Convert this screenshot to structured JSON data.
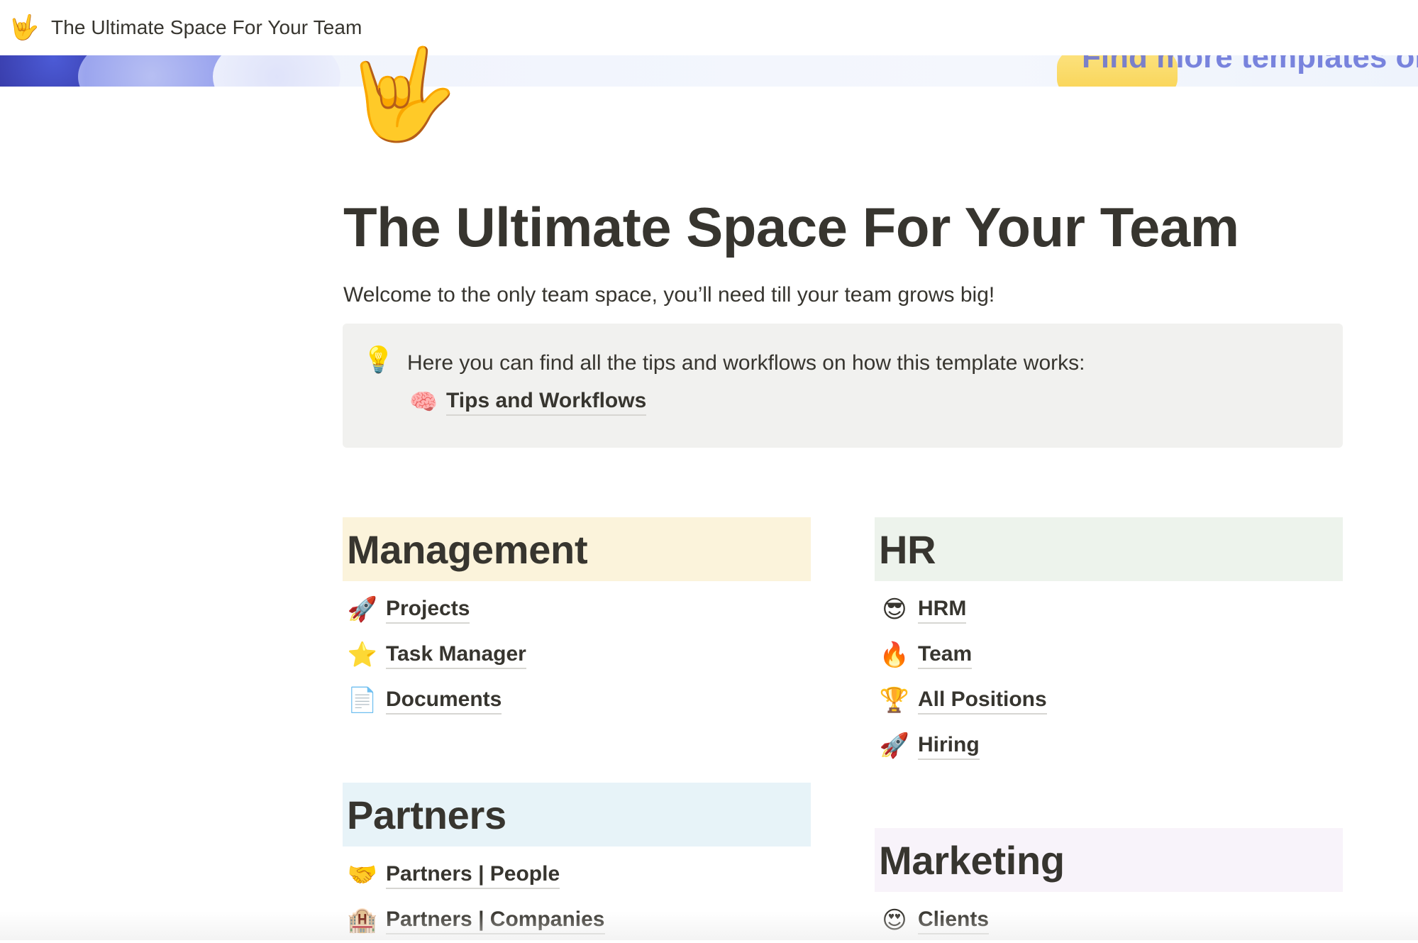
{
  "window": {
    "icon": "🤟",
    "icon_name": "love-you-gesture-icon",
    "title": "The Ultimate Space For Your Team"
  },
  "cover": {
    "text": "Find more templates on ww"
  },
  "page": {
    "icon": "🤟",
    "title": "The Ultimate Space For Your Team",
    "subtitle": "Welcome to the only team space, you’ll need till your team grows big!"
  },
  "callout": {
    "icon": "💡",
    "text": "Here you can find all the tips and workflows on how this template works:",
    "link": {
      "icon": "🧠",
      "label": "Tips and Workflows"
    }
  },
  "sections": {
    "management": {
      "title": "Management",
      "color": "#fbf3db",
      "items": [
        {
          "icon": "🚀",
          "label": "Projects"
        },
        {
          "icon": "⭐",
          "label": "Task Manager"
        },
        {
          "icon": "📄",
          "label": "Documents"
        }
      ]
    },
    "partners": {
      "title": "Partners",
      "color": "#e7f3f8",
      "items": [
        {
          "icon": "🤝",
          "label": "Partners | People"
        },
        {
          "icon": "🏨",
          "label": "Partners | Companies"
        }
      ]
    },
    "hr": {
      "title": "HR",
      "color": "#edf3ec",
      "items": [
        {
          "icon": "😎",
          "label": "HRM"
        },
        {
          "icon": "🔥",
          "label": "Team"
        },
        {
          "icon": "🏆",
          "label": "All Positions"
        },
        {
          "icon": "🚀",
          "label": "Hiring"
        }
      ]
    },
    "marketing": {
      "title": "Marketing",
      "color": "#f8f3fa",
      "items": [
        {
          "icon": "😍",
          "label": "Clients"
        }
      ]
    }
  }
}
